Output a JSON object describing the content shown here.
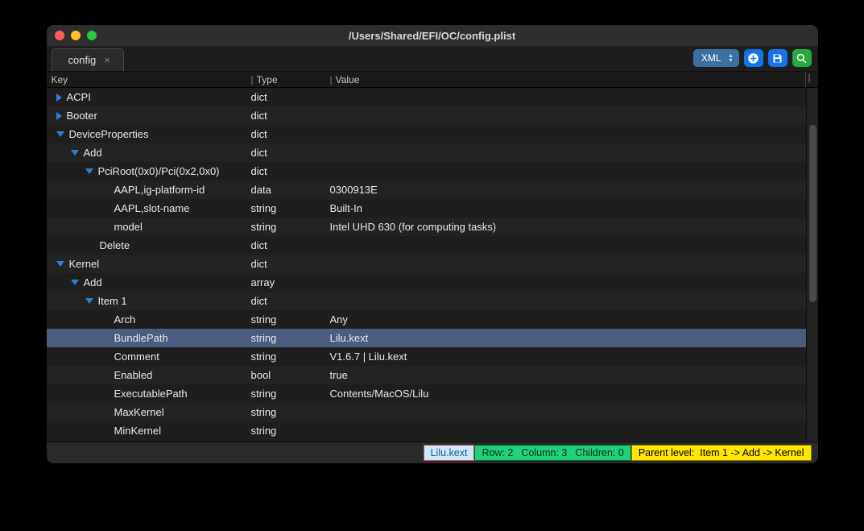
{
  "window_title": "/Users/Shared/EFI/OC/config.plist",
  "tab": {
    "name": "config",
    "close": "×"
  },
  "toolbar": {
    "format": "XML"
  },
  "header": {
    "key": "Key",
    "type": "Type",
    "value": "Value"
  },
  "rows": [
    {
      "indent": 1,
      "disc": "right",
      "key": "ACPI",
      "type": "dict",
      "value": ""
    },
    {
      "indent": 1,
      "disc": "right",
      "key": "Booter",
      "type": "dict",
      "value": ""
    },
    {
      "indent": 1,
      "disc": "down",
      "key": "DeviceProperties",
      "type": "dict",
      "value": ""
    },
    {
      "indent": 2,
      "disc": "down",
      "key": "Add",
      "type": "dict",
      "value": ""
    },
    {
      "indent": 3,
      "disc": "down",
      "key": "PciRoot(0x0)/Pci(0x2,0x0)",
      "type": "dict",
      "value": ""
    },
    {
      "indent": 4,
      "disc": "none",
      "key": "AAPL,ig-platform-id",
      "type": "data",
      "value": "0300913E"
    },
    {
      "indent": 4,
      "disc": "none",
      "key": "AAPL,slot-name",
      "type": "string",
      "value": "Built-In"
    },
    {
      "indent": 4,
      "disc": "none",
      "key": "model",
      "type": "string",
      "value": "Intel UHD 630 (for computing tasks)"
    },
    {
      "indent": 3,
      "disc": "none",
      "key": "Delete",
      "type": "dict",
      "value": ""
    },
    {
      "indent": 1,
      "disc": "down",
      "key": "Kernel",
      "type": "dict",
      "value": ""
    },
    {
      "indent": 2,
      "disc": "down",
      "key": "Add",
      "type": "array",
      "value": ""
    },
    {
      "indent": 3,
      "disc": "down",
      "key": "Item 1",
      "type": "dict",
      "value": ""
    },
    {
      "indent": 4,
      "disc": "none",
      "key": "Arch",
      "type": "string",
      "value": "Any"
    },
    {
      "indent": 4,
      "disc": "none",
      "key": "BundlePath",
      "type": "string",
      "value": "Lilu.kext",
      "selected": true
    },
    {
      "indent": 4,
      "disc": "none",
      "key": "Comment",
      "type": "string",
      "value": "V1.6.7 | Lilu.kext"
    },
    {
      "indent": 4,
      "disc": "none",
      "key": "Enabled",
      "type": "bool",
      "value": "true"
    },
    {
      "indent": 4,
      "disc": "none",
      "key": "ExecutablePath",
      "type": "string",
      "value": "Contents/MacOS/Lilu"
    },
    {
      "indent": 4,
      "disc": "none",
      "key": "MaxKernel",
      "type": "string",
      "value": ""
    },
    {
      "indent": 4,
      "disc": "none",
      "key": "MinKernel",
      "type": "string",
      "value": ""
    }
  ],
  "status": {
    "selection": "Lilu.kext",
    "row": "Row: 2",
    "column": "Column: 3",
    "children": "Children: 0",
    "path_label": "Parent level:",
    "path": "Item 1 -> Add -> Kernel"
  }
}
